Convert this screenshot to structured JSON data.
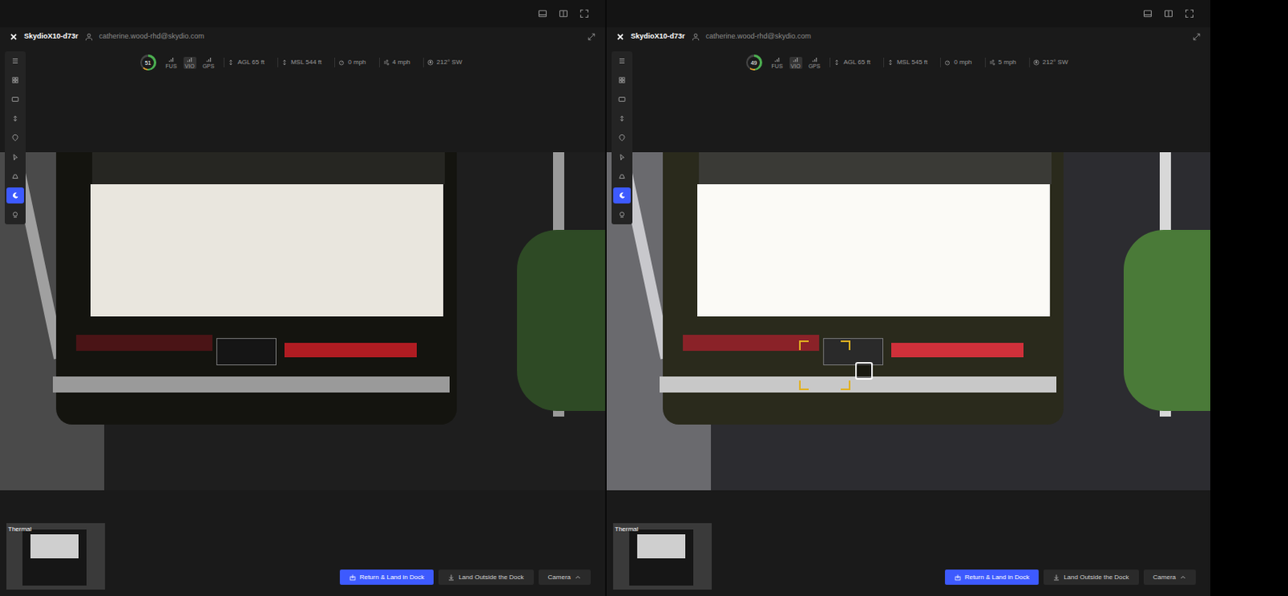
{
  "panels": [
    {
      "aircraft": "SkydioX10-d73r",
      "user": "catherine.wood-rhd@skydio.com",
      "battery": {
        "value": "51",
        "level": 0.51
      },
      "links": [
        "FUS",
        "VIO",
        "GPS"
      ],
      "telemetry": [
        {
          "kind": "altitude",
          "text": "AGL 65 ft"
        },
        {
          "kind": "altitude",
          "text": "MSL 544 ft"
        },
        {
          "kind": "speed",
          "text": "0 mph"
        },
        {
          "kind": "wind",
          "text": "4 mph"
        },
        {
          "kind": "heading",
          "text": "212° SW"
        }
      ],
      "sidebar": [
        {
          "selected": false
        },
        {
          "selected": false
        },
        {
          "selected": false
        },
        {
          "selected": false
        },
        {
          "selected": false
        },
        {
          "selected": false
        },
        {
          "selected": false
        },
        {
          "selected": true
        },
        {
          "selected": false
        }
      ],
      "thumbnail": {
        "label": "Thermal"
      },
      "buttons": [
        {
          "label": "Return & Land in Dock",
          "primary": true
        },
        {
          "label": "Land Outside the Dock",
          "primary": false
        },
        {
          "label": "Camera",
          "primary": false
        }
      ],
      "brightened": false,
      "target_box": false
    },
    {
      "aircraft": "SkydioX10-d73r",
      "user": "catherine.wood-rhd@skydio.com",
      "battery": {
        "value": "49",
        "level": 0.49
      },
      "links": [
        "FUS",
        "VIO",
        "GPS"
      ],
      "telemetry": [
        {
          "kind": "altitude",
          "text": "AGL 65 ft"
        },
        {
          "kind": "altitude",
          "text": "MSL 545 ft"
        },
        {
          "kind": "speed",
          "text": "0 mph"
        },
        {
          "kind": "wind",
          "text": "5 mph"
        },
        {
          "kind": "heading",
          "text": "212° SW"
        }
      ],
      "sidebar": [
        {
          "selected": false
        },
        {
          "selected": false
        },
        {
          "selected": false
        },
        {
          "selected": false
        },
        {
          "selected": false
        },
        {
          "selected": false
        },
        {
          "selected": false
        },
        {
          "selected": true
        },
        {
          "selected": false
        }
      ],
      "thumbnail": {
        "label": "Thermal"
      },
      "buttons": [
        {
          "label": "Return & Land in Dock",
          "primary": true
        },
        {
          "label": "Land Outside the Dock",
          "primary": false
        },
        {
          "label": "Camera",
          "primary": false
        }
      ],
      "brightened": true,
      "target_box": true
    }
  ]
}
